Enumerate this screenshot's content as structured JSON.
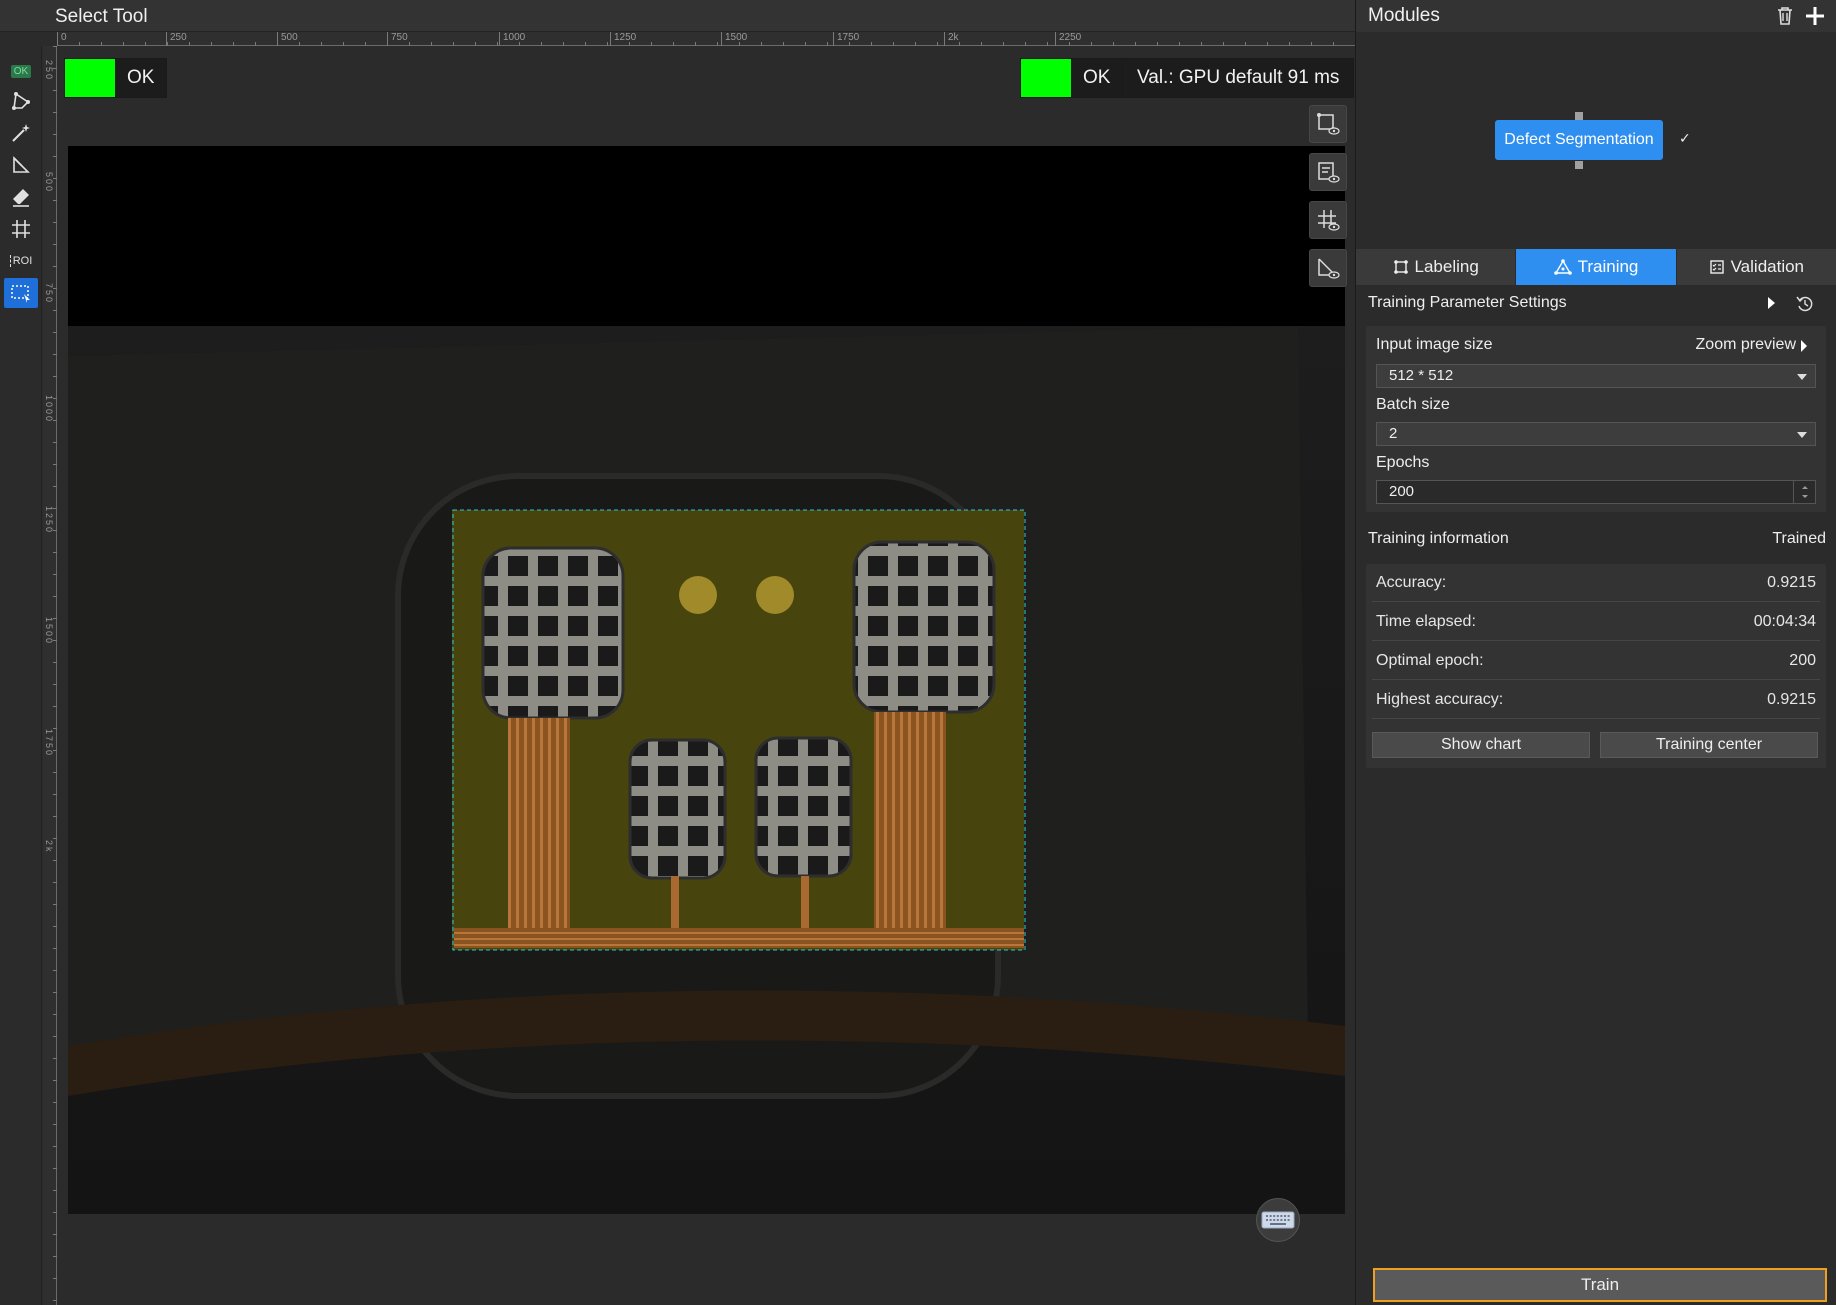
{
  "window": {
    "title": "Select Tool"
  },
  "toolbar": {
    "tools": [
      {
        "name": "ok-indicator",
        "label": "OK"
      },
      {
        "name": "polygon-tool",
        "label": ""
      },
      {
        "name": "magic-wand-tool",
        "label": ""
      },
      {
        "name": "smart-select-tool",
        "label": ""
      },
      {
        "name": "eraser-tool",
        "label": ""
      },
      {
        "name": "grid-tool",
        "label": ""
      },
      {
        "name": "roi-tool",
        "label": "ROI"
      },
      {
        "name": "select-tool",
        "label": ""
      }
    ]
  },
  "ruler": {
    "horizontal": [
      "0",
      "250",
      "500",
      "750",
      "1000",
      "1250",
      "1500",
      "1750",
      "2k",
      "2250"
    ],
    "vertical": [
      "250",
      "500",
      "750",
      "1000",
      "1250",
      "1500",
      "1750",
      "2k"
    ]
  },
  "viewer": {
    "left_badge": {
      "label": "OK",
      "color": "#00ff00"
    },
    "right_badge": {
      "label": "OK",
      "color": "#00ff00"
    },
    "validation": "Val.:  GPU default 91 ms"
  },
  "modules": {
    "title": "Modules",
    "node": {
      "label": "Defect Segmentation",
      "check": "✓"
    }
  },
  "tabs": [
    {
      "label": "Labeling",
      "icon": "labeling-icon",
      "active": false
    },
    {
      "label": "Training",
      "icon": "training-icon",
      "active": true
    },
    {
      "label": "Validation",
      "icon": "validation-icon",
      "active": false
    }
  ],
  "training_params": {
    "title": "Training Parameter Settings",
    "input_image_size": {
      "label": "Input image size",
      "value": "512 * 512"
    },
    "zoom_preview": "Zoom preview",
    "batch_size": {
      "label": "Batch size",
      "value": "2"
    },
    "epochs": {
      "label": "Epochs",
      "value": "200"
    }
  },
  "training_info": {
    "title": "Training information",
    "status": "Trained",
    "rows": [
      {
        "key": "Accuracy:",
        "value": "0.9215"
      },
      {
        "key": "Time elapsed:",
        "value": "00:04:34"
      },
      {
        "key": "Optimal epoch:",
        "value": "200"
      },
      {
        "key": "Highest accuracy:",
        "value": "0.9215"
      }
    ],
    "show_chart": "Show chart",
    "training_center": "Training center"
  },
  "train_button": "Train",
  "colors": {
    "accent": "#2f8ff0",
    "ok": "#00ff00",
    "train_border": "#f0a020"
  }
}
